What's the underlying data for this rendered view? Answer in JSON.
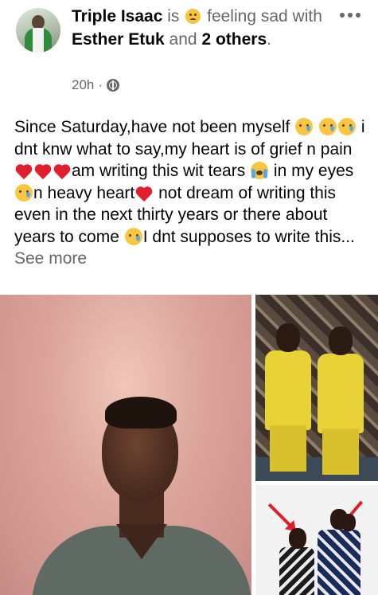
{
  "post": {
    "author": "Triple Isaac",
    "is_word": "is",
    "feeling_text": "feeling sad",
    "with_word": "with",
    "tagged": "Esther Etuk",
    "and_word": "and",
    "others": "2 others",
    "period": ".",
    "time": "20h",
    "separator": "·",
    "privacy_icon": "globe-icon",
    "more_icon": "more-dots-icon",
    "text_parts": {
      "p1": "Since Saturday,have not been myself ",
      "p2": " i dnt knw what to say,my heart is of grief n pain ",
      "p3": "am writing this wit tears ",
      "p4": " in my eyes ",
      "p5": "n heavy heart",
      "p6": " not dream of writing this even in the next thirty years or there about years to come ",
      "p7": "I dnt supposes to write this... "
    },
    "see_more": "See more"
  },
  "photos": [
    {
      "name": "portrait-photo"
    },
    {
      "name": "twins-yellow-photo"
    },
    {
      "name": "kids-arrows-photo"
    }
  ]
}
